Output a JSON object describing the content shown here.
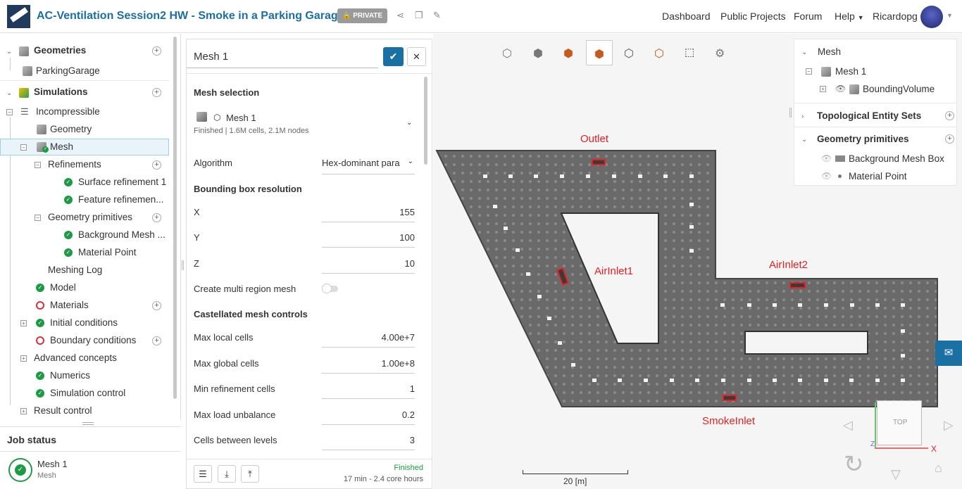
{
  "header": {
    "project_title": "AC-Ventilation Session2 HW - Smoke in a Parking Garage",
    "privacy_badge": "PRIVATE",
    "nav": [
      "Dashboard",
      "Public Projects",
      "Forum",
      "Help",
      "Ricardopg"
    ]
  },
  "tree": {
    "geometries_label": "Geometries",
    "geometry_item": "ParkingGarage",
    "simulations_label": "Simulations",
    "incompressible": "Incompressible",
    "geometry": "Geometry",
    "mesh": "Mesh",
    "refinements": "Refinements",
    "surface_refinement": "Surface refinement 1",
    "feature_refinement": "Feature refinemen...",
    "geometry_primitives": "Geometry primitives",
    "background_mesh": "Background Mesh ...",
    "material_point": "Material Point",
    "meshing_log": "Meshing Log",
    "model": "Model",
    "materials": "Materials",
    "initial_conditions": "Initial conditions",
    "boundary_conditions": "Boundary conditions",
    "advanced_concepts": "Advanced concepts",
    "numerics": "Numerics",
    "simulation_control": "Simulation control",
    "result_control": "Result control"
  },
  "job_status": {
    "title": "Job status",
    "job_name": "Mesh 1",
    "job_type": "Mesh"
  },
  "mesh_panel": {
    "name": "Mesh 1",
    "mesh_selection_label": "Mesh selection",
    "selected_mesh": "Mesh 1",
    "selected_mesh_info": "Finished | 1.6M cells, 2.1M nodes",
    "algorithm_label": "Algorithm",
    "algorithm_value": "Hex-dominant para",
    "bbox_label": "Bounding box resolution",
    "x_label": "X",
    "x_value": "155",
    "y_label": "Y",
    "y_value": "100",
    "z_label": "Z",
    "z_value": "10",
    "multi_region_label": "Create multi region mesh",
    "castellated_label": "Castellated mesh controls",
    "max_local_label": "Max local cells",
    "max_local_value": "4.00e+7",
    "max_global_label": "Max global cells",
    "max_global_value": "1.00e+8",
    "min_ref_label": "Min refinement cells",
    "min_ref_value": "1",
    "max_load_label": "Max load unbalance",
    "max_load_value": "0.2",
    "cells_between_label": "Cells between levels",
    "cells_between_value": "3",
    "status": "Finished",
    "status_detail": "17 min - 2.4 core hours"
  },
  "scene_tree": {
    "mesh_header": "Mesh",
    "mesh_item": "Mesh 1",
    "bounding_volume": "BoundingVolume",
    "topological_sets": "Topological Entity Sets",
    "geometry_primitives": "Geometry primitives",
    "background_mesh_box": "Background Mesh Box",
    "material_point": "Material Point"
  },
  "viewport": {
    "labels": {
      "outlet": "Outlet",
      "airinlet1": "AirInlet1",
      "airinlet2": "AirInlet2",
      "smokeinlet": "SmokeInlet"
    },
    "scale_label": "20 [m]",
    "axis_top": "TOP",
    "axis_x": "X",
    "axis_z": "Z"
  },
  "colors": {
    "accent": "#1a6fa3",
    "ok": "#1e9a45",
    "error": "#d8313c",
    "label_red": "#e8201f",
    "chat_button": "#1a6fa3"
  }
}
